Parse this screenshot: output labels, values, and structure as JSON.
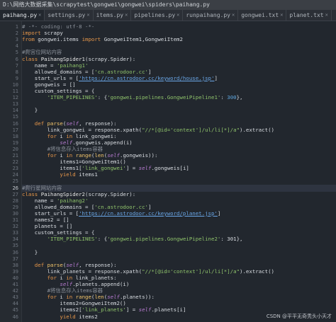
{
  "window": {
    "title": "D:\\网络大数据采集\\scrapytest\\gongwei\\gongwei\\spiders\\paihang.py"
  },
  "tabs": [
    {
      "label": "paihang.py",
      "active": true
    },
    {
      "label": "settings.py",
      "active": false
    },
    {
      "label": "items.py",
      "active": false
    },
    {
      "label": "pipelines.py",
      "active": false
    },
    {
      "label": "runpaihang.py",
      "active": false
    },
    {
      "label": "gongwei.txt",
      "active": false
    },
    {
      "label": "planet.txt",
      "active": false
    }
  ],
  "current_line": 26,
  "code_lines": [
    {
      "n": 1,
      "spans": [
        [
          "c-comment",
          "# -*- coding: utf-8 -*-"
        ]
      ]
    },
    {
      "n": 2,
      "spans": [
        [
          "c-kw",
          "import"
        ],
        [
          "",
          " scrapy"
        ]
      ]
    },
    {
      "n": 3,
      "spans": [
        [
          "c-kw",
          "from"
        ],
        [
          "",
          " gongwei.items "
        ],
        [
          "c-kw",
          "import"
        ],
        [
          "",
          " GongweiItem1,GongweiItem2"
        ]
      ]
    },
    {
      "n": 4,
      "spans": []
    },
    {
      "n": 5,
      "spans": [
        [
          "c-comment",
          "#爬宫位网站内容"
        ]
      ]
    },
    {
      "n": 6,
      "spans": [
        [
          "c-kw",
          "class"
        ],
        [
          "c-cls",
          " PaihangSpider1"
        ],
        [
          "",
          "(scrapy.Spider):"
        ]
      ]
    },
    {
      "n": 7,
      "spans": [
        [
          "",
          "    name = "
        ],
        [
          "c-str",
          "'paihang1'"
        ]
      ]
    },
    {
      "n": 8,
      "spans": [
        [
          "",
          "    allowed_domains = ["
        ],
        [
          "c-str",
          "'cn.astrodoor.cc'"
        ],
        [
          "",
          "]"
        ]
      ]
    },
    {
      "n": 9,
      "spans": [
        [
          "",
          "    start_urls = ["
        ],
        [
          "c-url",
          "'https://cn.astrodoor.cc/keyword/house.jsp'"
        ],
        [
          "",
          "]"
        ]
      ]
    },
    {
      "n": 10,
      "spans": [
        [
          "",
          "    gongweis = []"
        ]
      ]
    },
    {
      "n": 11,
      "spans": [
        [
          "",
          "    custom_settings = {"
        ]
      ]
    },
    {
      "n": 12,
      "spans": [
        [
          "c-str",
          "        'ITEM_PIPELINES'"
        ],
        [
          "",
          ": {"
        ],
        [
          "c-str",
          "'gongwei.pipelines.GongweiPipeline1'"
        ],
        [
          "",
          ": "
        ],
        [
          "c-num",
          "300"
        ],
        [
          "",
          "},"
        ]
      ]
    },
    {
      "n": 13,
      "spans": []
    },
    {
      "n": 14,
      "spans": [
        [
          "",
          "    }"
        ]
      ]
    },
    {
      "n": 15,
      "spans": []
    },
    {
      "n": 16,
      "spans": [
        [
          "c-kw",
          "    def"
        ],
        [
          "c-fn",
          " parse"
        ],
        [
          "",
          "("
        ],
        [
          "c-self",
          "self"
        ],
        [
          "",
          ", response):"
        ]
      ]
    },
    {
      "n": 17,
      "spans": [
        [
          "",
          "        link_gongwei = response.xpath("
        ],
        [
          "c-str",
          "\"//*[@id='context']/ul/li[*]/a\""
        ],
        [
          "",
          ").extract()"
        ]
      ]
    },
    {
      "n": 18,
      "spans": [
        [
          "c-kw",
          "        for"
        ],
        [
          "",
          " i "
        ],
        [
          "c-kw",
          "in"
        ],
        [
          "",
          " link_gongwei:"
        ]
      ]
    },
    {
      "n": 19,
      "spans": [
        [
          "c-self",
          "            self"
        ],
        [
          "",
          ".gongweis.append(i)"
        ]
      ]
    },
    {
      "n": 20,
      "spans": [
        [
          "c-comment",
          "        #将信息存入items容器"
        ]
      ]
    },
    {
      "n": 21,
      "spans": [
        [
          "c-kw",
          "        for"
        ],
        [
          "",
          " i "
        ],
        [
          "c-kw",
          "in"
        ],
        [
          "c-fn",
          " range"
        ],
        [
          "",
          "("
        ],
        [
          "c-fn",
          "len"
        ],
        [
          "",
          "("
        ],
        [
          "c-self",
          "self"
        ],
        [
          "",
          ".gongweis)):"
        ]
      ]
    },
    {
      "n": 22,
      "spans": [
        [
          "",
          "            items1=GongweiItem1()"
        ]
      ]
    },
    {
      "n": 23,
      "spans": [
        [
          "",
          "            items1["
        ],
        [
          "c-str",
          "'link_gongwei'"
        ],
        [
          "",
          "] = "
        ],
        [
          "c-self",
          "self"
        ],
        [
          "",
          ".gongweis[i]"
        ]
      ]
    },
    {
      "n": 24,
      "spans": [
        [
          "c-kw",
          "            yield"
        ],
        [
          "",
          " items1"
        ]
      ]
    },
    {
      "n": 25,
      "spans": []
    },
    {
      "n": 26,
      "spans": [
        [
          "c-comment",
          "#爬行星网站内容"
        ]
      ]
    },
    {
      "n": 27,
      "spans": [
        [
          "c-kw",
          "class"
        ],
        [
          "c-cls",
          " PaihangSpider2"
        ],
        [
          "",
          "(scrapy.Spider):"
        ]
      ]
    },
    {
      "n": 28,
      "spans": [
        [
          "",
          "    name = "
        ],
        [
          "c-str",
          "'paihang2'"
        ]
      ]
    },
    {
      "n": 29,
      "spans": [
        [
          "",
          "    allowed_domains = ["
        ],
        [
          "c-str",
          "'cn.astrodoor.cc'"
        ],
        [
          "",
          "]"
        ]
      ]
    },
    {
      "n": 30,
      "spans": [
        [
          "",
          "    start_urls = ["
        ],
        [
          "c-url",
          "'https://cn.astrodoor.cc/keyword/planet.jsp'"
        ],
        [
          "",
          "]"
        ]
      ]
    },
    {
      "n": 31,
      "spans": [
        [
          "",
          "    names2 = []"
        ]
      ]
    },
    {
      "n": 32,
      "spans": [
        [
          "",
          "    planets = []"
        ]
      ]
    },
    {
      "n": 33,
      "spans": [
        [
          "",
          "    custom_settings = {"
        ]
      ]
    },
    {
      "n": 34,
      "spans": [
        [
          "c-str",
          "        'ITEM_PIPELINES'"
        ],
        [
          "",
          ": {"
        ],
        [
          "c-str",
          "'gongwei.pipelines.GongweiPipeline2'"
        ],
        [
          "",
          ": 301},"
        ]
      ]
    },
    {
      "n": 35,
      "spans": []
    },
    {
      "n": 36,
      "spans": [
        [
          "",
          "    }"
        ]
      ]
    },
    {
      "n": 37,
      "spans": []
    },
    {
      "n": 38,
      "spans": [
        [
          "c-kw",
          "    def"
        ],
        [
          "c-fn",
          " parse"
        ],
        [
          "",
          "("
        ],
        [
          "c-self",
          "self"
        ],
        [
          "",
          ", response):"
        ]
      ]
    },
    {
      "n": 39,
      "spans": [
        [
          "",
          "        link_planets = response.xpath("
        ],
        [
          "c-str",
          "\"//*[@id='context']/ul/li[*]/a\""
        ],
        [
          "",
          ").extract()"
        ]
      ]
    },
    {
      "n": 40,
      "spans": [
        [
          "c-kw",
          "        for"
        ],
        [
          "",
          " i "
        ],
        [
          "c-kw",
          "in"
        ],
        [
          "",
          " link_planets:"
        ]
      ]
    },
    {
      "n": 41,
      "spans": [
        [
          "c-self",
          "            self"
        ],
        [
          "",
          ".planets.append(i)"
        ]
      ]
    },
    {
      "n": 42,
      "spans": [
        [
          "c-comment",
          "        #将信息存入items容器"
        ]
      ]
    },
    {
      "n": 43,
      "spans": [
        [
          "c-kw",
          "        for"
        ],
        [
          "",
          " i "
        ],
        [
          "c-kw",
          "in"
        ],
        [
          "c-fn",
          " range"
        ],
        [
          "",
          "("
        ],
        [
          "c-fn",
          "len"
        ],
        [
          "",
          "("
        ],
        [
          "c-self",
          "self"
        ],
        [
          "",
          ".planets)):"
        ]
      ]
    },
    {
      "n": 44,
      "spans": [
        [
          "",
          "            items2=GongweiItem2()"
        ]
      ]
    },
    {
      "n": 45,
      "spans": [
        [
          "",
          "            items2["
        ],
        [
          "c-str",
          "'link_planets'"
        ],
        [
          "",
          "] = "
        ],
        [
          "c-self",
          "self"
        ],
        [
          "",
          ".planets[i]"
        ]
      ]
    },
    {
      "n": 46,
      "spans": [
        [
          "c-kw",
          "            yield"
        ],
        [
          "",
          " items2"
        ]
      ]
    }
  ],
  "watermark": "CSDN @平平无奇秃头小天才",
  "colors": {
    "background": "#22272e",
    "keyword": "#e7974a",
    "string": "#8fc36b",
    "comment": "#8a9099",
    "self": "#b77bd1"
  }
}
